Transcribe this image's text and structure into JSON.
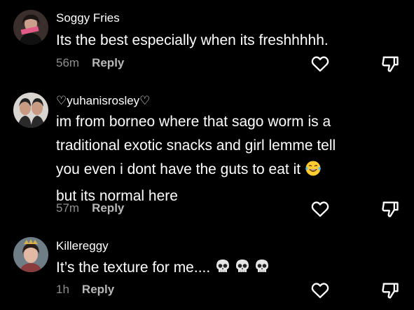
{
  "comments": [
    {
      "username": "Soggy Fries",
      "text_lines": [
        "Its the best especially when its freshhhhh."
      ],
      "time": "56m",
      "reply_label": "Reply"
    },
    {
      "username": "♡yuhanisrosley♡",
      "text_lines": [
        "im from borneo where that sago worm is a",
        "traditional exotic snacks and girl lemme tell",
        "you even i dont have the guts to eat it",
        "but its normal here"
      ],
      "emoji_after_line_3": "laughing-tears",
      "time": "57m",
      "reply_label": "Reply"
    },
    {
      "username": "Killereggy",
      "text_lines": [
        "It’s the texture for me...."
      ],
      "emoji_after_line_1": [
        "skull",
        "skull",
        "skull"
      ],
      "time": "1h",
      "reply_label": "Reply"
    }
  ],
  "icons": {
    "like": "heart-outline-icon",
    "dislike": "thumbs-down-icon"
  },
  "colors": {
    "background": "#000000",
    "text": "#ffffff",
    "meta": "#8e8e8e"
  }
}
